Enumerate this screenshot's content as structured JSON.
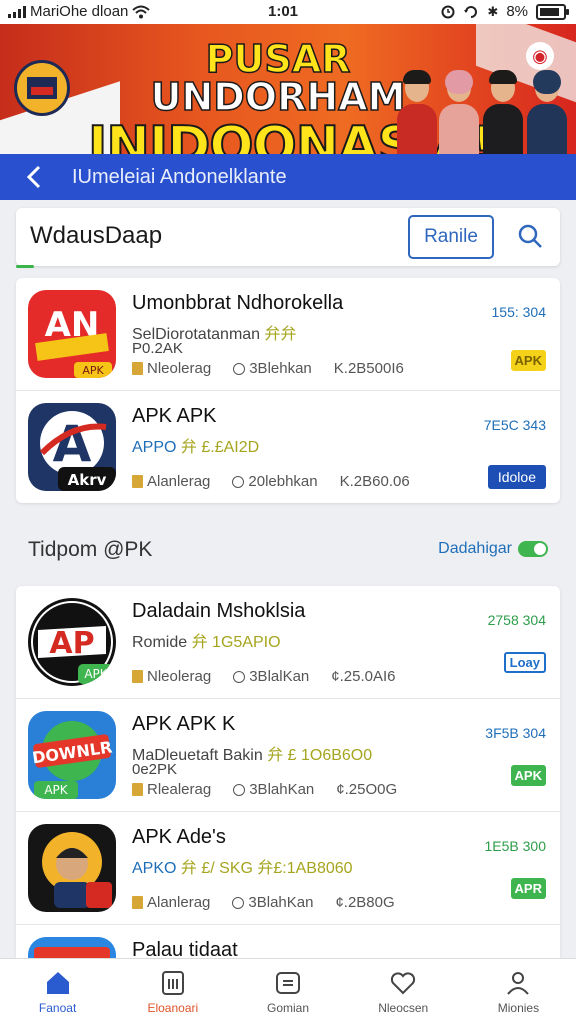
{
  "status_bar": {
    "carrier": "MariOhe dloan",
    "time": "1:01",
    "battery": "8%",
    "battery_level": 0.85
  },
  "banner": {
    "title_line1_a": "PUSAR",
    "title_line1_b": "UNDORHAM",
    "title_line2": "INIDOONASIA!"
  },
  "app_bar": {
    "title": "IUmeleiai Andonelklante"
  },
  "search": {
    "query": "WdausDaap",
    "filter_label": "Ranile"
  },
  "top_list": [
    {
      "title": "Umonbbrat Ndhorokella",
      "subtitle": "SelDiorotatanman",
      "subtitle_hl": "弁弁",
      "line2": "P0.2AK",
      "category": "Nleolerag",
      "date": "3Blehkan",
      "downloads": "K.2B500I6",
      "size": "155: 304",
      "badge": "APK"
    },
    {
      "title": "APK APK",
      "subtitle": "APPO",
      "subtitle_hl": "弁 £.£AI2D",
      "line2": "",
      "category": "Alanlerag",
      "date": "20lebhkan",
      "downloads": "K.2B60.06",
      "size": "7E5C 343",
      "badge": "Idoloe"
    }
  ],
  "section": {
    "title": "Tidpom @PK",
    "link": "Dadahigar"
  },
  "bottom_list": [
    {
      "title": "Daladain Mshoklsia",
      "subtitle": "Romide",
      "subtitle_hl": "弁 1G5APIO",
      "line2": "",
      "category": "Nleolerag",
      "date": "3BlalKan",
      "downloads": "¢.25.0AI6",
      "size": "2758 304",
      "badge": "Loay"
    },
    {
      "title": "APK APK K",
      "subtitle": "MaDleuetaft Bakin",
      "subtitle_hl": "弁 £ 1O6B6O0",
      "line2": "0e2PK",
      "category": "Rlealerag",
      "date": "3BlahKan",
      "downloads": "¢.25O0G",
      "size": "3F5B 304",
      "badge": "APK"
    },
    {
      "title": "APK Ade's",
      "subtitle": "APKO",
      "subtitle_hl": "弁 £/ SKG 弁£:1AB8060",
      "line2": "",
      "category": "Alanlerag",
      "date": "3BlahKan",
      "downloads": "¢.2B80G",
      "size": "1E5B 300",
      "badge": "APR"
    },
    {
      "title": "Palau tidaat",
      "subtitle": "",
      "subtitle_hl": "",
      "line2": "",
      "category": "",
      "date": "",
      "downloads": "",
      "size": "",
      "badge": ""
    }
  ],
  "bottom_nav": [
    {
      "label": "Fanoat",
      "icon": "home-icon"
    },
    {
      "label": "Eloanoari",
      "icon": "apps-icon"
    },
    {
      "label": "Gomian",
      "icon": "games-icon"
    },
    {
      "label": "Nleocsen",
      "icon": "heart-icon"
    },
    {
      "label": "Mionies",
      "icon": "profile-icon"
    }
  ],
  "colors": {
    "app_bar": "#2950ce",
    "accent_blue": "#2f67bd",
    "accent_green": "#3fb54f",
    "accent_yellow": "#f5d21a"
  }
}
